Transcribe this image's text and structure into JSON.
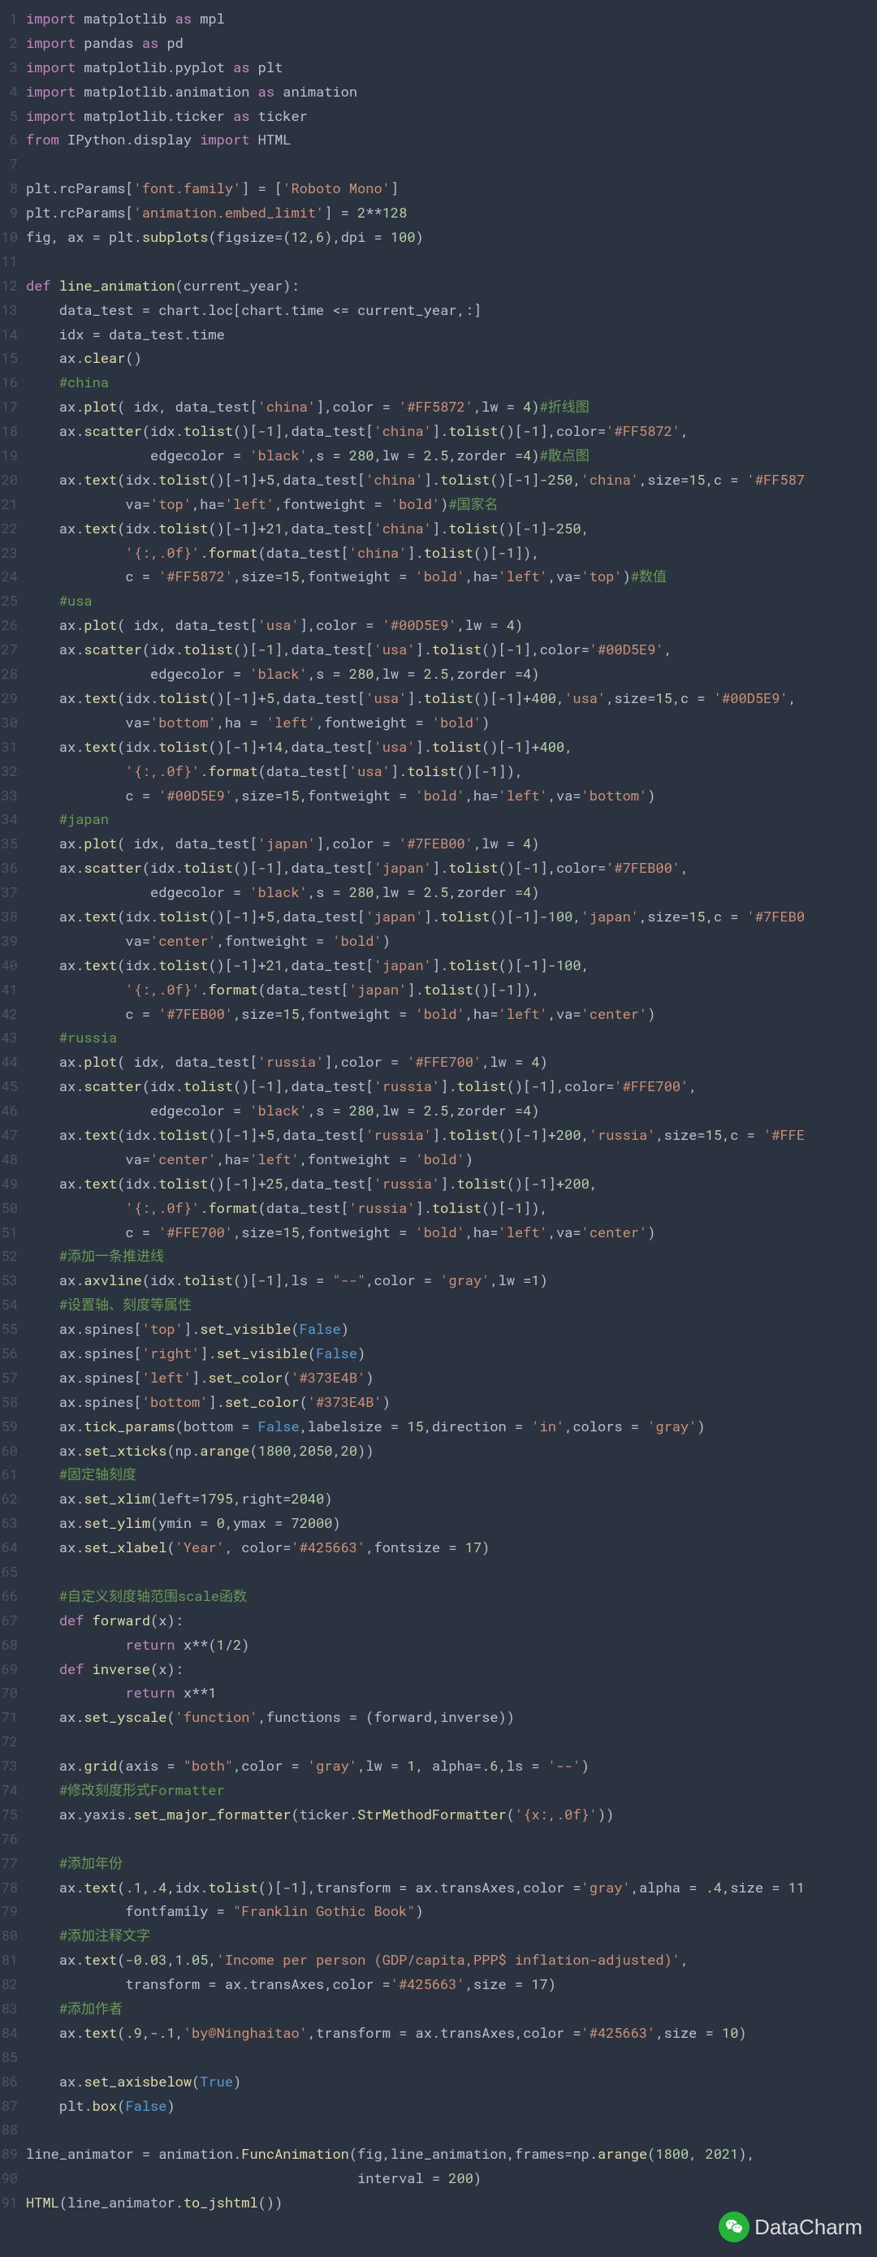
{
  "watermark": {
    "text": "DataCharm"
  },
  "lines": [
    {
      "n": 1,
      "html": "<span class='tk-kw'>import</span> matplotlib <span class='tk-kw'>as</span> mpl"
    },
    {
      "n": 2,
      "html": "<span class='tk-kw'>import</span> pandas <span class='tk-kw'>as</span> pd"
    },
    {
      "n": 3,
      "html": "<span class='tk-kw'>import</span> matplotlib.pyplot <span class='tk-kw'>as</span> plt"
    },
    {
      "n": 4,
      "html": "<span class='tk-kw'>import</span> matplotlib.animation <span class='tk-kw'>as</span> animation"
    },
    {
      "n": 5,
      "html": "<span class='tk-kw'>import</span> matplotlib.ticker <span class='tk-kw'>as</span> ticker"
    },
    {
      "n": 6,
      "html": "<span class='tk-kw'>from</span> IPython.display <span class='tk-kw'>import</span> HTML"
    },
    {
      "n": 7,
      "html": ""
    },
    {
      "n": 8,
      "html": "plt.rcParams[<span class='tk-str'>'font.family'</span>] = [<span class='tk-str'>'Roboto Mono'</span>]"
    },
    {
      "n": 9,
      "html": "plt.rcParams[<span class='tk-str'>'animation.embed_limit'</span>] = <span class='tk-num'>2</span>**<span class='tk-num'>128</span>"
    },
    {
      "n": 10,
      "html": "fig, ax = plt.<span class='tk-func'>subplots</span>(figsize=(<span class='tk-num'>12</span>,<span class='tk-num'>6</span>),dpi = <span class='tk-num'>100</span>)"
    },
    {
      "n": 11,
      "html": ""
    },
    {
      "n": 12,
      "html": "<span class='tk-kw'>def</span> <span class='tk-def'>line_animation</span>(current_year):"
    },
    {
      "n": 13,
      "html": "    data_test = chart.loc[chart.time <span class='tk-op'>&lt;=</span> current_year,:]"
    },
    {
      "n": 14,
      "html": "    idx = data_test.time"
    },
    {
      "n": 15,
      "html": "    ax.<span class='tk-func'>clear</span>()"
    },
    {
      "n": 16,
      "html": "    <span class='tk-cmt'>#china</span>"
    },
    {
      "n": 17,
      "html": "    ax.<span class='tk-func'>plot</span>( idx, data_test[<span class='tk-str'>'china'</span>],color = <span class='tk-str'>'#FF5872'</span>,lw = <span class='tk-num'>4</span>)<span class='tk-cmt'>#折线图</span>"
    },
    {
      "n": 18,
      "html": "    ax.<span class='tk-func'>scatter</span>(idx.<span class='tk-func'>tolist</span>()[-<span class='tk-num'>1</span>],data_test[<span class='tk-str'>'china'</span>].<span class='tk-func'>tolist</span>()[-<span class='tk-num'>1</span>],color=<span class='tk-str'>'#FF5872'</span>,"
    },
    {
      "n": 19,
      "html": "               edgecolor = <span class='tk-str'>'black'</span>,s = <span class='tk-num'>280</span>,lw = <span class='tk-num'>2.5</span>,zorder =<span class='tk-num'>4</span>)<span class='tk-cmt'>#散点图</span>"
    },
    {
      "n": 20,
      "html": "    ax.<span class='tk-func'>text</span>(idx.<span class='tk-func'>tolist</span>()[-<span class='tk-num'>1</span>]+<span class='tk-num'>5</span>,data_test[<span class='tk-str'>'china'</span>].<span class='tk-func'>tolist</span>()[-<span class='tk-num'>1</span>]-<span class='tk-num'>250</span>,<span class='tk-str'>'china'</span>,size=<span class='tk-num'>15</span>,c = <span class='tk-str'>'#FF587</span>"
    },
    {
      "n": 21,
      "html": "            va=<span class='tk-str'>'top'</span>,ha=<span class='tk-str'>'left'</span>,fontweight = <span class='tk-str'>'bold'</span>)<span class='tk-cmt'>#国家名</span>"
    },
    {
      "n": 22,
      "html": "    ax.<span class='tk-func'>text</span>(idx.<span class='tk-func'>tolist</span>()[-<span class='tk-num'>1</span>]+<span class='tk-num'>21</span>,data_test[<span class='tk-str'>'china'</span>].<span class='tk-func'>tolist</span>()[-<span class='tk-num'>1</span>]-<span class='tk-num'>250</span>,"
    },
    {
      "n": 23,
      "html": "            <span class='tk-str'>'{:,.0f}'</span>.<span class='tk-func'>format</span>(data_test[<span class='tk-str'>'china'</span>].<span class='tk-func'>tolist</span>()[-<span class='tk-num'>1</span>]),"
    },
    {
      "n": 24,
      "html": "            c = <span class='tk-str'>'#FF5872'</span>,size=<span class='tk-num'>15</span>,fontweight = <span class='tk-str'>'bold'</span>,ha=<span class='tk-str'>'left'</span>,va=<span class='tk-str'>'top'</span>)<span class='tk-cmt'>#数值</span>"
    },
    {
      "n": 25,
      "html": "    <span class='tk-cmt'>#usa</span>"
    },
    {
      "n": 26,
      "html": "    ax.<span class='tk-func'>plot</span>( idx, data_test[<span class='tk-str'>'usa'</span>],color = <span class='tk-str'>'#00D5E9'</span>,lw = <span class='tk-num'>4</span>)"
    },
    {
      "n": 27,
      "html": "    ax.<span class='tk-func'>scatter</span>(idx.<span class='tk-func'>tolist</span>()[-<span class='tk-num'>1</span>],data_test[<span class='tk-str'>'usa'</span>].<span class='tk-func'>tolist</span>()[-<span class='tk-num'>1</span>],color=<span class='tk-str'>'#00D5E9'</span>,"
    },
    {
      "n": 28,
      "html": "               edgecolor = <span class='tk-str'>'black'</span>,s = <span class='tk-num'>280</span>,lw = <span class='tk-num'>2.5</span>,zorder =<span class='tk-num'>4</span>)"
    },
    {
      "n": 29,
      "html": "    ax.<span class='tk-func'>text</span>(idx.<span class='tk-func'>tolist</span>()[-<span class='tk-num'>1</span>]+<span class='tk-num'>5</span>,data_test[<span class='tk-str'>'usa'</span>].<span class='tk-func'>tolist</span>()[-<span class='tk-num'>1</span>]+<span class='tk-num'>400</span>,<span class='tk-str'>'usa'</span>,size=<span class='tk-num'>15</span>,c = <span class='tk-str'>'#00D5E9'</span>,"
    },
    {
      "n": 30,
      "html": "            va=<span class='tk-str'>'bottom'</span>,ha = <span class='tk-str'>'left'</span>,fontweight = <span class='tk-str'>'bold'</span>)"
    },
    {
      "n": 31,
      "html": "    ax.<span class='tk-func'>text</span>(idx.<span class='tk-func'>tolist</span>()[-<span class='tk-num'>1</span>]+<span class='tk-num'>14</span>,data_test[<span class='tk-str'>'usa'</span>].<span class='tk-func'>tolist</span>()[-<span class='tk-num'>1</span>]+<span class='tk-num'>400</span>,"
    },
    {
      "n": 32,
      "html": "            <span class='tk-str'>'{:,.0f}'</span>.<span class='tk-func'>format</span>(data_test[<span class='tk-str'>'usa'</span>].<span class='tk-func'>tolist</span>()[-<span class='tk-num'>1</span>]),"
    },
    {
      "n": 33,
      "html": "            c = <span class='tk-str'>'#00D5E9'</span>,size=<span class='tk-num'>15</span>,fontweight = <span class='tk-str'>'bold'</span>,ha=<span class='tk-str'>'left'</span>,va=<span class='tk-str'>'bottom'</span>)"
    },
    {
      "n": 34,
      "html": "    <span class='tk-cmt'>#japan</span>"
    },
    {
      "n": 35,
      "html": "    ax.<span class='tk-func'>plot</span>( idx, data_test[<span class='tk-str'>'japan'</span>],color = <span class='tk-str'>'#7FEB00'</span>,lw = <span class='tk-num'>4</span>)"
    },
    {
      "n": 36,
      "html": "    ax.<span class='tk-func'>scatter</span>(idx.<span class='tk-func'>tolist</span>()[-<span class='tk-num'>1</span>],data_test[<span class='tk-str'>'japan'</span>].<span class='tk-func'>tolist</span>()[-<span class='tk-num'>1</span>],color=<span class='tk-str'>'#7FEB00'</span>,"
    },
    {
      "n": 37,
      "html": "               edgecolor = <span class='tk-str'>'black'</span>,s = <span class='tk-num'>280</span>,lw = <span class='tk-num'>2.5</span>,zorder =<span class='tk-num'>4</span>)"
    },
    {
      "n": 38,
      "html": "    ax.<span class='tk-func'>text</span>(idx.<span class='tk-func'>tolist</span>()[-<span class='tk-num'>1</span>]+<span class='tk-num'>5</span>,data_test[<span class='tk-str'>'japan'</span>].<span class='tk-func'>tolist</span>()[-<span class='tk-num'>1</span>]-<span class='tk-num'>100</span>,<span class='tk-str'>'japan'</span>,size=<span class='tk-num'>15</span>,c = <span class='tk-str'>'#7FEB0</span>"
    },
    {
      "n": 39,
      "html": "            va=<span class='tk-str'>'center'</span>,fontweight = <span class='tk-str'>'bold'</span>)"
    },
    {
      "n": 40,
      "html": "    ax.<span class='tk-func'>text</span>(idx.<span class='tk-func'>tolist</span>()[-<span class='tk-num'>1</span>]+<span class='tk-num'>21</span>,data_test[<span class='tk-str'>'japan'</span>].<span class='tk-func'>tolist</span>()[-<span class='tk-num'>1</span>]-<span class='tk-num'>100</span>,"
    },
    {
      "n": 41,
      "html": "            <span class='tk-str'>'{:,.0f}'</span>.<span class='tk-func'>format</span>(data_test[<span class='tk-str'>'japan'</span>].<span class='tk-func'>tolist</span>()[-<span class='tk-num'>1</span>]),"
    },
    {
      "n": 42,
      "html": "            c = <span class='tk-str'>'#7FEB00'</span>,size=<span class='tk-num'>15</span>,fontweight = <span class='tk-str'>'bold'</span>,ha=<span class='tk-str'>'left'</span>,va=<span class='tk-str'>'center'</span>)"
    },
    {
      "n": 43,
      "html": "    <span class='tk-cmt'>#russia</span>"
    },
    {
      "n": 44,
      "html": "    ax.<span class='tk-func'>plot</span>( idx, data_test[<span class='tk-str'>'russia'</span>],color = <span class='tk-str'>'#FFE700'</span>,lw = <span class='tk-num'>4</span>)"
    },
    {
      "n": 45,
      "html": "    ax.<span class='tk-func'>scatter</span>(idx.<span class='tk-func'>tolist</span>()[-<span class='tk-num'>1</span>],data_test[<span class='tk-str'>'russia'</span>].<span class='tk-func'>tolist</span>()[-<span class='tk-num'>1</span>],color=<span class='tk-str'>'#FFE700'</span>,"
    },
    {
      "n": 46,
      "html": "               edgecolor = <span class='tk-str'>'black'</span>,s = <span class='tk-num'>280</span>,lw = <span class='tk-num'>2.5</span>,zorder =<span class='tk-num'>4</span>)"
    },
    {
      "n": 47,
      "html": "    ax.<span class='tk-func'>text</span>(idx.<span class='tk-func'>tolist</span>()[-<span class='tk-num'>1</span>]+<span class='tk-num'>5</span>,data_test[<span class='tk-str'>'russia'</span>].<span class='tk-func'>tolist</span>()[-<span class='tk-num'>1</span>]+<span class='tk-num'>200</span>,<span class='tk-str'>'russia'</span>,size=<span class='tk-num'>15</span>,c = <span class='tk-str'>'#FFE</span>"
    },
    {
      "n": 48,
      "html": "            va=<span class='tk-str'>'center'</span>,ha=<span class='tk-str'>'left'</span>,fontweight = <span class='tk-str'>'bold'</span>)"
    },
    {
      "n": 49,
      "html": "    ax.<span class='tk-func'>text</span>(idx.<span class='tk-func'>tolist</span>()[-<span class='tk-num'>1</span>]+<span class='tk-num'>25</span>,data_test[<span class='tk-str'>'russia'</span>].<span class='tk-func'>tolist</span>()[-<span class='tk-num'>1</span>]+<span class='tk-num'>200</span>,"
    },
    {
      "n": 50,
      "html": "            <span class='tk-str'>'{:,.0f}'</span>.<span class='tk-func'>format</span>(data_test[<span class='tk-str'>'russia'</span>].<span class='tk-func'>tolist</span>()[-<span class='tk-num'>1</span>]),"
    },
    {
      "n": 51,
      "html": "            c = <span class='tk-str'>'#FFE700'</span>,size=<span class='tk-num'>15</span>,fontweight = <span class='tk-str'>'bold'</span>,ha=<span class='tk-str'>'left'</span>,va=<span class='tk-str'>'center'</span>)"
    },
    {
      "n": 52,
      "html": "    <span class='tk-cmt'>#添加一条推进线</span>"
    },
    {
      "n": 53,
      "html": "    ax.<span class='tk-func'>axvline</span>(idx.<span class='tk-func'>tolist</span>()[-<span class='tk-num'>1</span>],ls = <span class='tk-str'>\"--\"</span>,color = <span class='tk-str'>'gray'</span>,lw =<span class='tk-num'>1</span>)"
    },
    {
      "n": 54,
      "html": "    <span class='tk-cmt'>#设置轴、刻度等属性</span>"
    },
    {
      "n": 55,
      "html": "    ax.spines[<span class='tk-str'>'top'</span>].<span class='tk-func'>set_visible</span>(<span class='tk-bool'>False</span>)"
    },
    {
      "n": 56,
      "html": "    ax.spines[<span class='tk-str'>'right'</span>].<span class='tk-func'>set_visible</span>(<span class='tk-bool'>False</span>)"
    },
    {
      "n": 57,
      "html": "    ax.spines[<span class='tk-str'>'left'</span>].<span class='tk-func'>set_color</span>(<span class='tk-str'>'#373E4B'</span>)"
    },
    {
      "n": 58,
      "html": "    ax.spines[<span class='tk-str'>'bottom'</span>].<span class='tk-func'>set_color</span>(<span class='tk-str'>'#373E4B'</span>)"
    },
    {
      "n": 59,
      "html": "    ax.<span class='tk-func'>tick_params</span>(bottom = <span class='tk-bool'>False</span>,labelsize = <span class='tk-num'>15</span>,direction = <span class='tk-str'>'in'</span>,colors = <span class='tk-str'>'gray'</span>)"
    },
    {
      "n": 60,
      "html": "    ax.<span class='tk-func'>set_xticks</span>(np.<span class='tk-func'>arange</span>(<span class='tk-num'>1800</span>,<span class='tk-num'>2050</span>,<span class='tk-num'>20</span>))"
    },
    {
      "n": 61,
      "html": "    <span class='tk-cmt'>#固定轴刻度</span>"
    },
    {
      "n": 62,
      "html": "    ax.<span class='tk-func'>set_xlim</span>(left=<span class='tk-num'>1795</span>,right=<span class='tk-num'>2040</span>)"
    },
    {
      "n": 63,
      "html": "    ax.<span class='tk-func'>set_ylim</span>(ymin = <span class='tk-num'>0</span>,ymax = <span class='tk-num'>72000</span>)"
    },
    {
      "n": 64,
      "html": "    ax.<span class='tk-func'>set_xlabel</span>(<span class='tk-str'>'Year'</span>, color=<span class='tk-str'>'#425663'</span>,fontsize = <span class='tk-num'>17</span>)"
    },
    {
      "n": 65,
      "html": ""
    },
    {
      "n": 66,
      "html": "    <span class='tk-cmt'>#自定义刻度轴范围scale函数</span>"
    },
    {
      "n": 67,
      "html": "    <span class='tk-kw'>def</span> <span class='tk-def'>forward</span>(x):"
    },
    {
      "n": 68,
      "html": "            <span class='tk-kw'>return</span> x**(<span class='tk-num'>1</span>/<span class='tk-num'>2</span>)"
    },
    {
      "n": 69,
      "html": "    <span class='tk-kw'>def</span> <span class='tk-def'>inverse</span>(x):"
    },
    {
      "n": 70,
      "html": "            <span class='tk-kw'>return</span> x**<span class='tk-num'>1</span>"
    },
    {
      "n": 71,
      "html": "    ax.<span class='tk-func'>set_yscale</span>(<span class='tk-str'>'function'</span>,functions = (forward,inverse))"
    },
    {
      "n": 72,
      "html": ""
    },
    {
      "n": 73,
      "html": "    ax.<span class='tk-func'>grid</span>(axis = <span class='tk-str'>\"both\"</span>,color = <span class='tk-str'>'gray'</span>,lw = <span class='tk-num'>1</span>, alpha=<span class='tk-num'>.6</span>,ls = <span class='tk-str'>'--'</span>)"
    },
    {
      "n": 74,
      "html": "    <span class='tk-cmt'>#修改刻度形式Formatter</span>"
    },
    {
      "n": 75,
      "html": "    ax.yaxis.<span class='tk-func'>set_major_formatter</span>(ticker.<span class='tk-func'>StrMethodFormatter</span>(<span class='tk-str'>'{x:,.0f}'</span>))"
    },
    {
      "n": 76,
      "html": ""
    },
    {
      "n": 77,
      "html": "    <span class='tk-cmt'>#添加年份</span>"
    },
    {
      "n": 78,
      "html": "    ax.<span class='tk-func'>text</span>(<span class='tk-num'>.1</span>,<span class='tk-num'>.4</span>,idx.<span class='tk-func'>tolist</span>()[-<span class='tk-num'>1</span>],transform = ax.transAxes,color =<span class='tk-str'>'gray'</span>,alpha = <span class='tk-num'>.4</span>,size = <span class='tk-num'>11</span>"
    },
    {
      "n": 79,
      "html": "            fontfamily = <span class='tk-str'>\"Franklin Gothic Book\"</span>)"
    },
    {
      "n": 80,
      "html": "    <span class='tk-cmt'>#添加注释文字</span>"
    },
    {
      "n": 81,
      "html": "    ax.<span class='tk-func'>text</span>(-<span class='tk-num'>0.03</span>,<span class='tk-num'>1.05</span>,<span class='tk-str'>'Income per person (GDP/capita,PPP$ inflation-adjusted)'</span>,"
    },
    {
      "n": 82,
      "html": "            transform = ax.transAxes,color =<span class='tk-str'>'#425663'</span>,size = <span class='tk-num'>17</span>)"
    },
    {
      "n": 83,
      "html": "    <span class='tk-cmt'>#添加作者</span>"
    },
    {
      "n": 84,
      "html": "    ax.<span class='tk-func'>text</span>(<span class='tk-num'>.9</span>,-<span class='tk-num'>.1</span>,<span class='tk-str'>'by@Ninghaitao'</span>,transform = ax.transAxes,color =<span class='tk-str'>'#425663'</span>,size = <span class='tk-num'>10</span>)"
    },
    {
      "n": 85,
      "html": ""
    },
    {
      "n": 86,
      "html": "    ax.<span class='tk-func'>set_axisbelow</span>(<span class='tk-bool'>True</span>)"
    },
    {
      "n": 87,
      "html": "    plt.<span class='tk-func'>box</span>(<span class='tk-bool'>False</span>)"
    },
    {
      "n": 88,
      "html": ""
    },
    {
      "n": 89,
      "html": "line_animator = animation.<span class='tk-func'>FuncAnimation</span>(fig,line_animation,frames=np.<span class='tk-func'>arange</span>(<span class='tk-num'>1800</span>, <span class='tk-num'>2021</span>),"
    },
    {
      "n": 90,
      "html": "                                        interval = <span class='tk-num'>200</span>)"
    },
    {
      "n": 91,
      "html": "<span class='tk-func'>HTML</span>(line_animator.<span class='tk-func'>to_jshtml</span>())"
    }
  ]
}
